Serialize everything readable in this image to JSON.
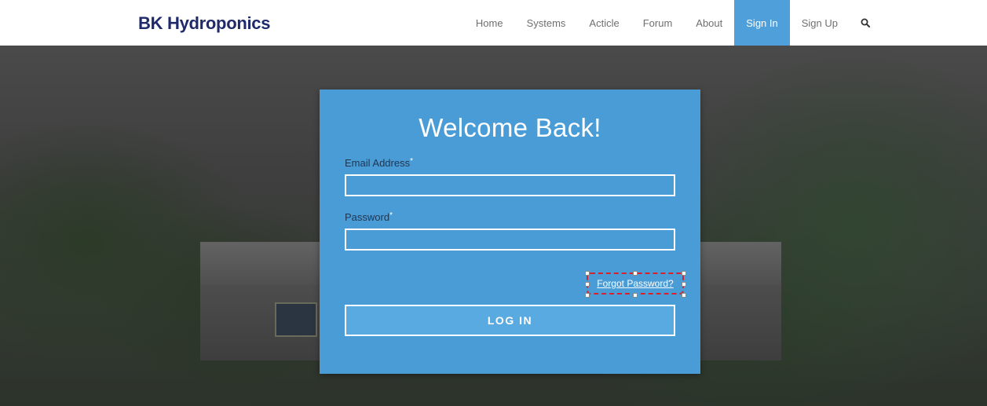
{
  "header": {
    "brand": "BK Hydroponics",
    "nav": [
      {
        "label": "Home",
        "active": false
      },
      {
        "label": "Systems",
        "active": false
      },
      {
        "label": "Acticle",
        "active": false
      },
      {
        "label": "Forum",
        "active": false
      },
      {
        "label": "About",
        "active": false
      },
      {
        "label": "Sign In",
        "active": true
      },
      {
        "label": "Sign Up",
        "active": false
      }
    ],
    "search_icon": "search-icon"
  },
  "login": {
    "title": "Welcome Back!",
    "email_label": "Email Address",
    "email_required": "*",
    "email_value": "",
    "password_label": "Password",
    "password_required": "*",
    "password_value": "",
    "forgot_label": "Forgot Password?",
    "submit_label": "LOG IN"
  },
  "colors": {
    "brand": "#1f2a6b",
    "accent": "#4f9fdb",
    "card": "#4a9cd6",
    "highlight": "#d8212a"
  }
}
